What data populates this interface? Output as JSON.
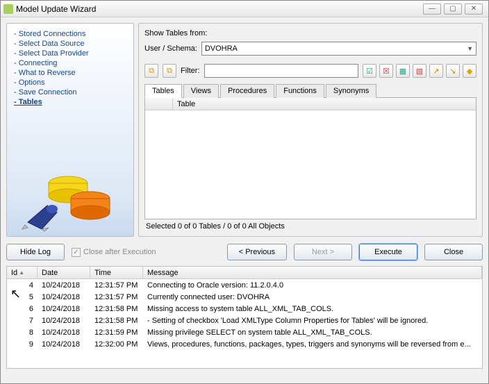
{
  "window": {
    "title": "Model Update Wizard"
  },
  "nav": {
    "items": [
      {
        "label": "Stored Connections"
      },
      {
        "label": "Select Data Source"
      },
      {
        "label": "Select Data Provider"
      },
      {
        "label": "Connecting"
      },
      {
        "label": "What to Reverse"
      },
      {
        "label": "Options"
      },
      {
        "label": "Save Connection"
      },
      {
        "label": "Tables"
      }
    ],
    "active_index": 7,
    "prefix": "- "
  },
  "right": {
    "show_from_label": "Show Tables from:",
    "schema_label": "User / Schema:",
    "schema_value": "DVOHRA",
    "filter_label": "Filter:",
    "tabs": [
      "Tables",
      "Views",
      "Procedures",
      "Functions",
      "Synonyms"
    ],
    "list_col_checkbox": "",
    "list_col_table": "Table",
    "status": "Selected 0 of 0 Tables / 0 of 0 All Objects",
    "toolbar_icons": [
      "select-all-icon",
      "select-none-icon",
      "filter-apply-icon",
      "filter-clear-icon",
      "include-toggle-icon",
      "exclude-toggle-icon",
      "highlight-icon"
    ]
  },
  "buttons": {
    "hide_log": "Hide Log",
    "close_after_exec": "Close after Execution",
    "previous": "< Previous",
    "next": "Next >",
    "execute": "Execute",
    "close": "Close"
  },
  "log": {
    "columns": {
      "id": "Id",
      "date": "Date",
      "time": "Time",
      "message": "Message"
    },
    "rows": [
      {
        "id": "4",
        "date": "10/24/2018",
        "time": "12:31:57 PM",
        "msg": "Connecting to Oracle version: 11.2.0.4.0"
      },
      {
        "id": "5",
        "date": "10/24/2018",
        "time": "12:31:57 PM",
        "msg": "Currently connected user: DVOHRA"
      },
      {
        "id": "6",
        "date": "10/24/2018",
        "time": "12:31:58 PM",
        "msg": "Missing access to system table ALL_XML_TAB_COLS."
      },
      {
        "id": "7",
        "date": "10/24/2018",
        "time": "12:31:58 PM",
        "msg": "  - Setting of checkbox 'Load XMLType Column Properties for Tables' will be ignored."
      },
      {
        "id": "8",
        "date": "10/24/2018",
        "time": "12:31:59 PM",
        "msg": "Missing privilege SELECT on system table ALL_XML_TAB_COLS."
      },
      {
        "id": "9",
        "date": "10/24/2018",
        "time": "12:32:00 PM",
        "msg": "Views, procedures, functions, packages, types, triggers and synonyms will be reversed from e..."
      }
    ]
  }
}
